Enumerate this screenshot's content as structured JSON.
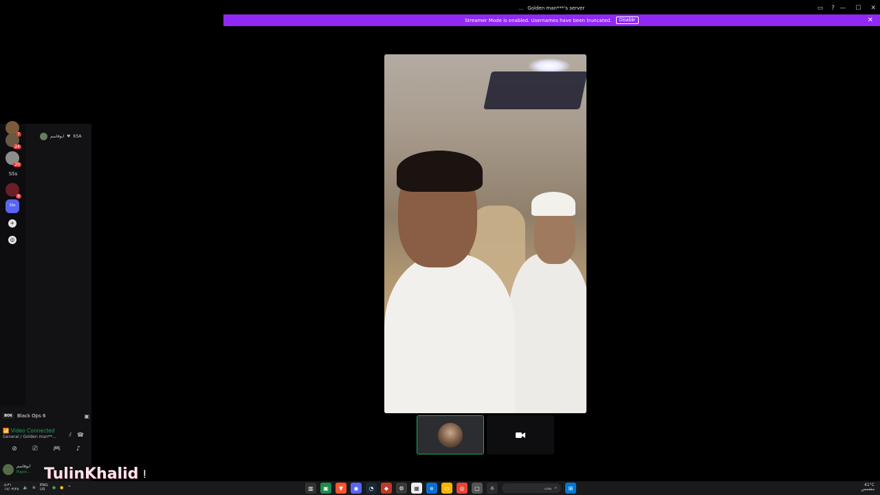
{
  "window": {
    "title_icon": "...",
    "title": "Golden man***'s server",
    "controls": [
      "—",
      "☐",
      "✕"
    ]
  },
  "banner": {
    "message": "Streamer Mode is enabled. Usernames have been truncated.",
    "disable_label": "Disable",
    "color": "#9128f5"
  },
  "guilds": [
    {
      "badge": "7"
    },
    {
      "badge": "24"
    },
    {
      "badge": "20"
    },
    {
      "label": "SSs"
    },
    {
      "badge": "8"
    },
    {
      "label": "SSs"
    }
  ],
  "member": {
    "name": "ابوقاسم",
    "tag": "KSA"
  },
  "activity": {
    "game_logo": "BO6",
    "game": "Black Ops 6"
  },
  "voice": {
    "status": "Video Connected",
    "channel": "General / Golden man**..."
  },
  "user": {
    "name": "ابوقاسم",
    "status": "Playin..."
  },
  "watermark": "TulinKhalid",
  "taskbar": {
    "time": "٥:٣١",
    "date": "١٧/٠٣/٢٥",
    "lang_top": "ENG",
    "lang_bottom": "US",
    "search_placeholder": "بحث",
    "weather_temp": "41°C",
    "weather_desc": "مشمس"
  }
}
